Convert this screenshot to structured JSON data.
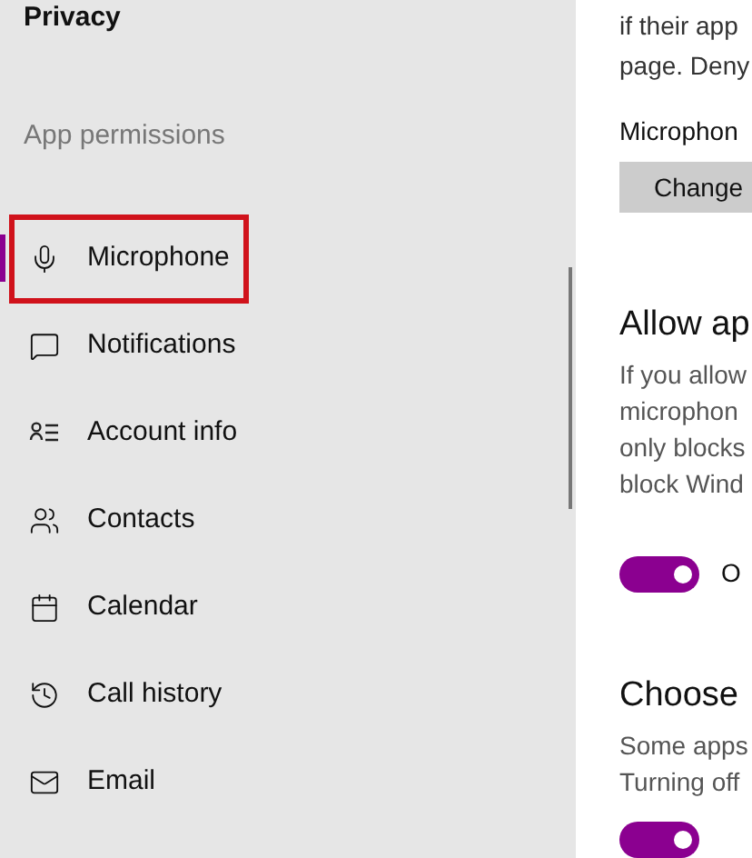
{
  "sidebar": {
    "title": "Privacy",
    "group_label": "App permissions",
    "items": [
      {
        "label": "Microphone",
        "kind": "mic",
        "selected": true,
        "annotated": true
      },
      {
        "label": "Notifications",
        "kind": "message",
        "selected": false,
        "annotated": false
      },
      {
        "label": "Account info",
        "kind": "account",
        "selected": false,
        "annotated": false
      },
      {
        "label": "Contacts",
        "kind": "contacts",
        "selected": false,
        "annotated": false
      },
      {
        "label": "Calendar",
        "kind": "calendar",
        "selected": false,
        "annotated": false
      },
      {
        "label": "Call history",
        "kind": "history",
        "selected": false,
        "annotated": false
      },
      {
        "label": "Email",
        "kind": "mail",
        "selected": false,
        "annotated": false
      }
    ]
  },
  "content": {
    "intro_lines": [
      "if their app",
      "page. Deny"
    ],
    "device_label": "Microphon",
    "change_button": "Change",
    "sections": [
      {
        "heading": "Allow ap",
        "lines": [
          "If you allow",
          "microphon",
          "only blocks",
          "block Wind"
        ],
        "toggle": {
          "on": true,
          "label": "O"
        }
      },
      {
        "heading": "Choose",
        "lines": [
          "Some apps",
          "Turning off"
        ],
        "toggle": {
          "on": true
        }
      }
    ]
  }
}
